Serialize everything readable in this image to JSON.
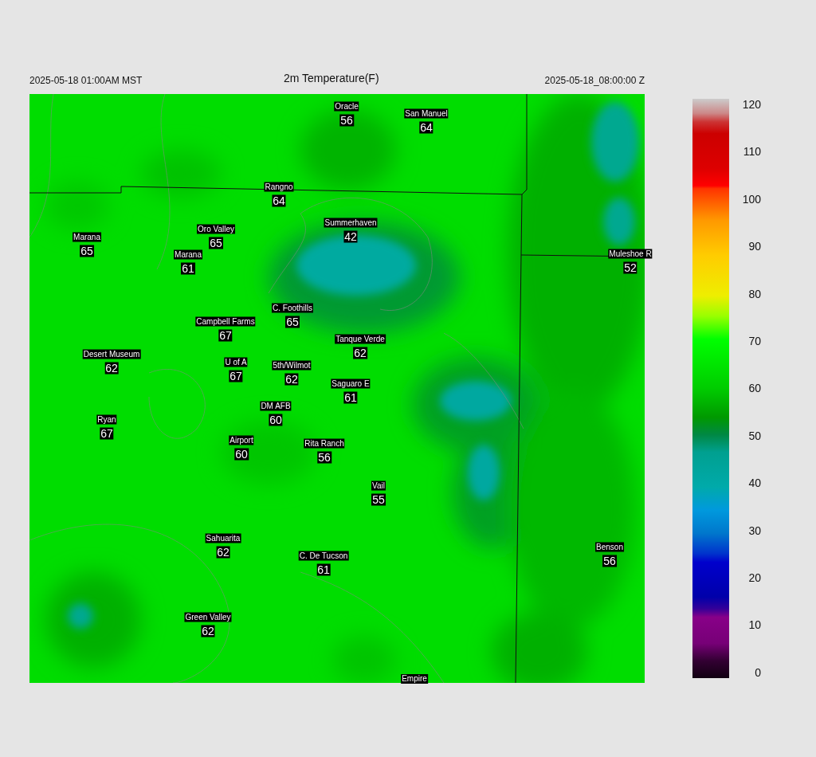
{
  "header": {
    "local_time": "2025-05-18 01:00AM MST",
    "title": "2m Temperature(F)",
    "utc_time": "2025-05-18_08:00:00 Z"
  },
  "stations": [
    {
      "name": "Oracle",
      "value": "56"
    },
    {
      "name": "San Manuel",
      "value": "64"
    },
    {
      "name": "Rangno",
      "value": "64"
    },
    {
      "name": "Summerhaven",
      "value": "42"
    },
    {
      "name": "Oro Valley",
      "value": "65"
    },
    {
      "name": "Marana",
      "value": "65"
    },
    {
      "name": "Marana",
      "value": "61"
    },
    {
      "name": "Muleshoe R",
      "value": "52"
    },
    {
      "name": "C. Foothills",
      "value": "65"
    },
    {
      "name": "Campbell Farms",
      "value": "67"
    },
    {
      "name": "Tanque Verde",
      "value": "62"
    },
    {
      "name": "Desert Museum",
      "value": "62"
    },
    {
      "name": "U of A",
      "value": "67"
    },
    {
      "name": "5th/Wilmot",
      "value": "62"
    },
    {
      "name": "Saguaro E",
      "value": "61"
    },
    {
      "name": "DM AFB",
      "value": "60"
    },
    {
      "name": "Ryan",
      "value": "67"
    },
    {
      "name": "Airport",
      "value": "60"
    },
    {
      "name": "Rita Ranch",
      "value": "56"
    },
    {
      "name": "Vail",
      "value": "55"
    },
    {
      "name": "Benson",
      "value": "56"
    },
    {
      "name": "Sahuarita",
      "value": "62"
    },
    {
      "name": "C. De Tucson",
      "value": "61"
    },
    {
      "name": "Green Valley",
      "value": "62"
    },
    {
      "name": "Empire"
    }
  ],
  "color_scale": {
    "labels": [
      "120",
      "110",
      "100",
      "90",
      "80",
      "70",
      "60",
      "50",
      "40",
      "30",
      "20",
      "10",
      "0"
    ]
  }
}
